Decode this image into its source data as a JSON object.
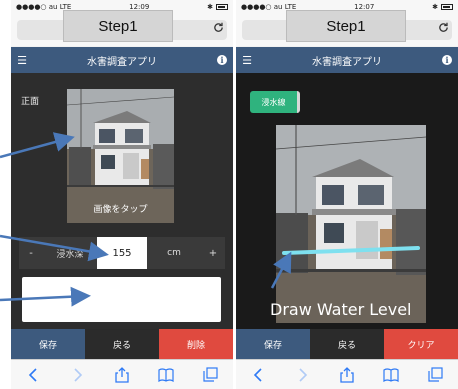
{
  "left_screen": {
    "status": {
      "carrier": "●●●●○ au  LTE",
      "time": "12:09",
      "bluetooth": "✱"
    },
    "step_label": "Step1",
    "app_title": "水害調査アプリ",
    "front_label": "正面",
    "tap_hint": "画像をタップ",
    "depth": {
      "minus": "-",
      "label": "浸水深",
      "value": "155",
      "unit": "cm",
      "plus": "+"
    },
    "buttons": {
      "save": "保存",
      "back": "戻る",
      "delete": "削除"
    }
  },
  "right_screen": {
    "status": {
      "carrier": "●●●●○ au  LTE",
      "time": "12:07",
      "bluetooth": "✱"
    },
    "step_label": "Step1",
    "app_title": "水害調査アプリ",
    "water_tag": "浸水線",
    "overlay_text": "Draw Water Level",
    "buttons": {
      "save": "保存",
      "back": "戻る",
      "clear": "クリア"
    }
  },
  "icons": {
    "menu": "hamburger-icon",
    "info": "info-icon",
    "reload": "reload-icon",
    "toolbar": [
      "back-icon",
      "forward-icon",
      "share-icon",
      "bookmarks-icon",
      "tabs-icon"
    ]
  },
  "colors": {
    "navbar": "#3d5a7e",
    "save_button": "#3d5a7e",
    "danger_button": "#e04a3f",
    "water_tag": "#2fb37e",
    "water_line": "#7ee0ef",
    "annotation_arrow": "#4a78b8",
    "ios_tint": "#2f7af5"
  }
}
